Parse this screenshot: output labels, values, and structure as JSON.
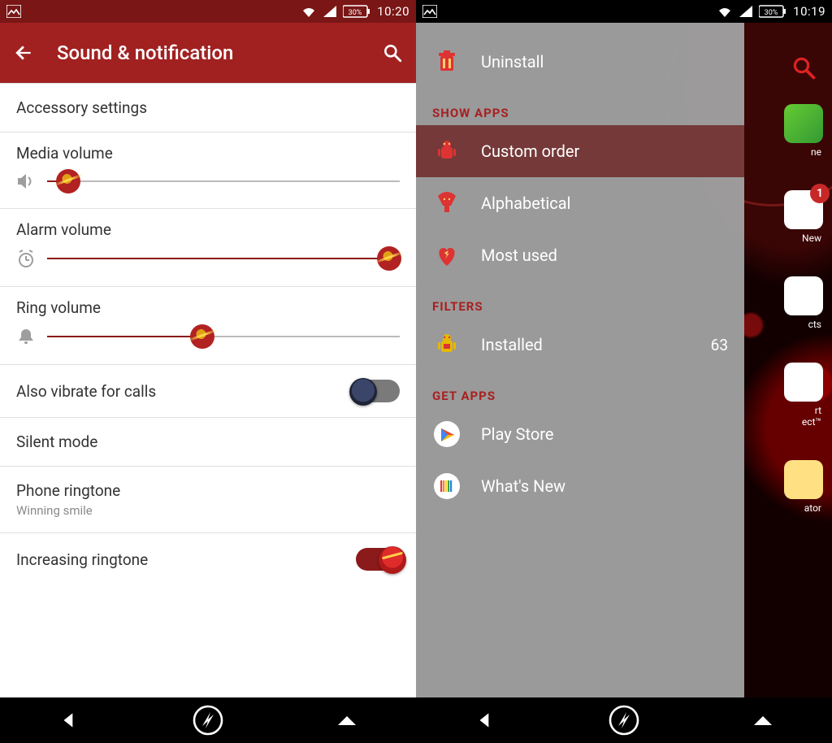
{
  "left": {
    "status": {
      "battery": "30%",
      "time": "10:20"
    },
    "header": {
      "title": "Sound & notification"
    },
    "items": {
      "accessory": "Accessory settings",
      "media": {
        "label": "Media volume",
        "pct": 6
      },
      "alarm": {
        "label": "Alarm volume",
        "pct": 97
      },
      "ring": {
        "label": "Ring volume",
        "pct": 44
      },
      "vibrate": {
        "label": "Also vibrate for calls",
        "on": false
      },
      "silent": "Silent mode",
      "ringtone": {
        "label": "Phone ringtone",
        "sub": "Winning smile"
      },
      "increasing": {
        "label": "Increasing ringtone",
        "on": true
      }
    }
  },
  "right": {
    "status": {
      "battery": "30%",
      "time": "10:19"
    },
    "drawer": {
      "top": {
        "uninstall": "Uninstall"
      },
      "showAppsTitle": "SHOW APPS",
      "showApps": {
        "custom": "Custom order",
        "alpha": "Alphabetical",
        "most": "Most used"
      },
      "filtersTitle": "FILTERS",
      "filters": {
        "installed": "Installed",
        "count": "63"
      },
      "getAppsTitle": "GET APPS",
      "getApps": {
        "store": "Play Store",
        "whatsnew": "What's New"
      }
    },
    "homeLabels": {
      "new": "New",
      "cts": "cts",
      "ect": "rt\nect™",
      "ator": "ator",
      "ne": "ne"
    }
  }
}
